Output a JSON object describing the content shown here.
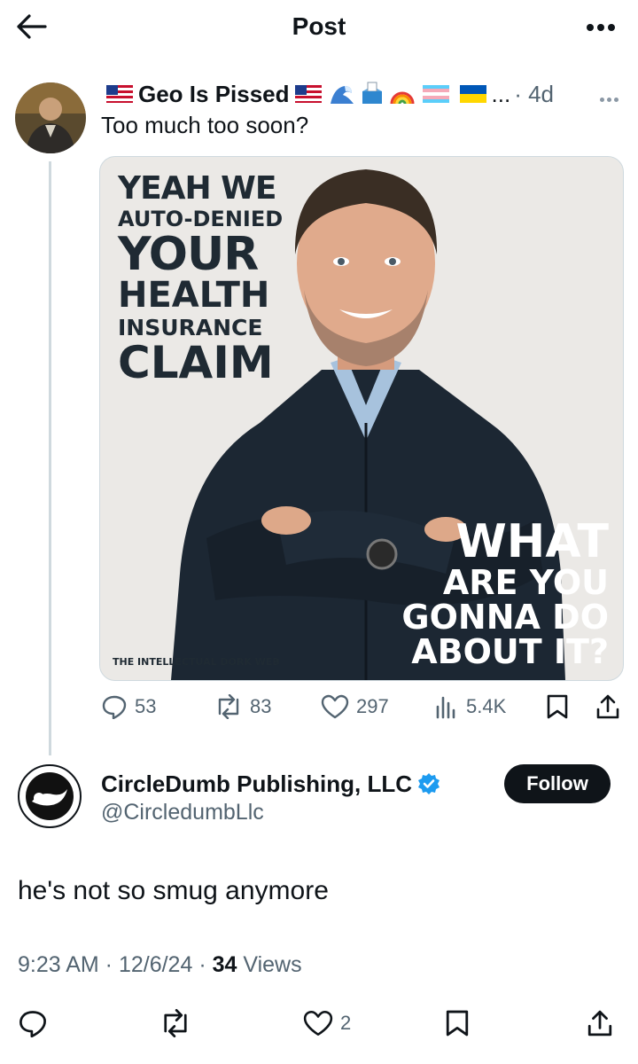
{
  "header": {
    "title": "Post"
  },
  "quoted_post": {
    "author_name": "Geo Is Pissed",
    "overflow": "...",
    "time": "4d",
    "text": "Too much too soon?",
    "image": {
      "left_lines": [
        "YEAH WE",
        "AUTO-DENIED",
        "YOUR",
        "HEALTH",
        "INSURANCE",
        "CLAIM"
      ],
      "right_lines": [
        "WHAT",
        "ARE YOU",
        "GONNA DO",
        "ABOUT IT?"
      ],
      "credit": "THE INTELLECTUAL DORK WEB"
    },
    "actions": {
      "replies": "53",
      "reposts": "83",
      "likes": "297",
      "views": "5.4K"
    }
  },
  "main_post": {
    "author_name": "CircleDumb Publishing, LLC",
    "handle": "@CircledumbLlc",
    "follow_label": "Follow",
    "text": "he's not so smug anymore",
    "time": "9:23 AM",
    "date": "12/6/24",
    "views_count": "34",
    "views_label": "Views",
    "actions": {
      "likes": "2"
    }
  },
  "colors": {
    "text": "#0f1419",
    "secondary": "#536471",
    "verified": "#1d9bf0",
    "border": "#cfd9de"
  },
  "icons": [
    "back-arrow-icon",
    "more-icon",
    "us-flag-icon",
    "wave-icon",
    "ballot-box-icon",
    "rainbow-icon",
    "trans-flag-icon",
    "ukraine-flag-icon",
    "reply-icon",
    "repost-icon",
    "like-icon",
    "views-icon",
    "bookmark-icon",
    "share-icon",
    "verified-badge-icon"
  ]
}
